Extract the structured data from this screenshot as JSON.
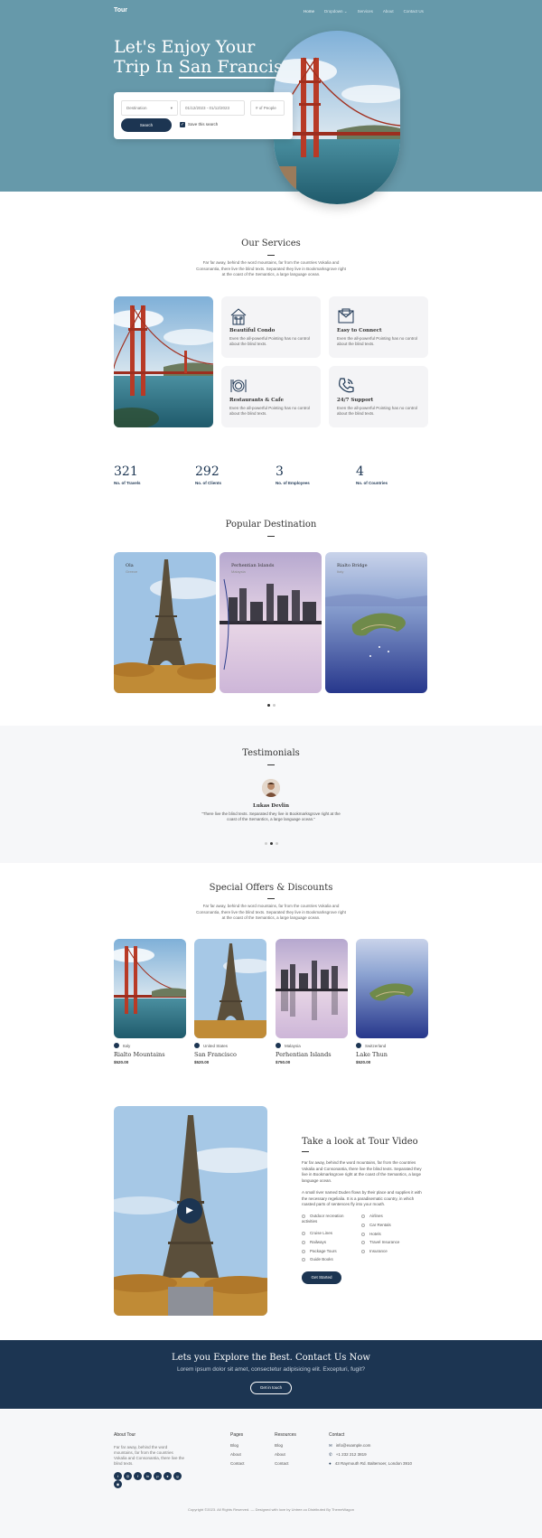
{
  "brand": {
    "logo": "Tour",
    "accent": "#1c3552",
    "hero_bg": "#6699aa"
  },
  "nav": {
    "items": [
      "Home",
      "Dropdown",
      "Services",
      "About",
      "Contact Us"
    ]
  },
  "hero": {
    "title_line1": "Let's Enjoy Your",
    "title_line2_prefix": "Trip In ",
    "title_highlight": "San Francisco.",
    "destination_placeholder": "Destination",
    "date_value": "01/12/2023 - 01/12/2023",
    "people_placeholder": "# of People",
    "search_label": "Search",
    "save_label": "Save this search"
  },
  "services": {
    "title": "Our Services",
    "subtitle": "Far far away, behind the word mountains, far from the countries Vokalia and Consonantia, there live the blind texts. Separated they live in Bookmarksgrove right at the coast of the Semantics, a large language ocean.",
    "cards": [
      {
        "icon": "condo-icon",
        "title": "Beautiful Condo",
        "text": "Even the all-powerful Pointing has no control about the blind texts."
      },
      {
        "icon": "email-icon",
        "title": "Easy to Connect",
        "text": "Even the all-powerful Pointing has no control about the blind texts."
      },
      {
        "icon": "dining-icon",
        "title": "Restaurants & Cafe",
        "text": "Even the all-powerful Pointing has no control about the blind texts."
      },
      {
        "icon": "phone-icon",
        "title": "24/7 Support",
        "text": "Even the all-powerful Pointing has no control about the blind texts."
      }
    ]
  },
  "stats": [
    {
      "num": "321",
      "label": "No. of Travels"
    },
    {
      "num": "292",
      "label": "No. of Clients"
    },
    {
      "num": "3",
      "label": "No. of Employees"
    },
    {
      "num": "4",
      "label": "No. of Countries"
    }
  ],
  "popular": {
    "title": "Popular Destination",
    "items": [
      {
        "name": "Ola",
        "sub": "Greece"
      },
      {
        "name": "Perhentian Islands",
        "sub": "Malaysia"
      },
      {
        "name": "Rialto Bridge",
        "sub": "Italy"
      }
    ]
  },
  "testimonials": {
    "title": "Testimonials",
    "name": "Lukas Devlin",
    "quote": "“There live the blind texts. Separated they live in Bookmarksgrove right at the coast of the Semantics, a large language ocean.”"
  },
  "offers": {
    "title": "Special Offers & Discounts",
    "subtitle": "Far far away, behind the word mountains, far from the countries Vokalia and Consonantia, there live the blind texts. Separated they live in Bookmarksgrove right at the coast of the Semantics, a large language ocean.",
    "items": [
      {
        "location": "Italy",
        "name": "Rialto Mountains",
        "price": "$520.00"
      },
      {
        "location": "United States",
        "name": "San Francisco",
        "price": "$520.00"
      },
      {
        "location": "Malaysia",
        "name": "Perhentian Islands",
        "price": "$750.00"
      },
      {
        "location": "Switzerland",
        "name": "Lake Thun",
        "price": "$520.00"
      }
    ]
  },
  "video": {
    "title": "Take a look at Tour Video",
    "p1": "Far far away, behind the word mountains, far from the countries Vokalia and Consonantia, there live the blind texts. Separated they live in Bookmarksgrove right at the coast of the Semantics, a large language ocean.",
    "p2": "A small river named Duden flows by their place and supplies it with the necessary regelialia. It is a paradisematic country, in which roasted parts of sentences fly into your mouth.",
    "col1": [
      "Outdoor recreation activities",
      "Cruise Lines",
      "Railways",
      "Package Tours",
      "Guide Books"
    ],
    "col2": [
      "Airlines",
      "Car Rentals",
      "Hotels",
      "Travel Insurance",
      "Insurance"
    ],
    "cta": "Get Started"
  },
  "cta": {
    "title": "Lets you Explore the Best. Contact Us Now",
    "subtitle": "Lorem ipsum dolor sit amet, consectetur adipisicing elit. Excepturi, fugit?",
    "button": "Get in touch"
  },
  "footer": {
    "about_title": "About Tour",
    "about_text": "Far far away, behind the word mountains, far from the countries Vokalia and Consonantia, there live the blind texts.",
    "pages_title": "Pages",
    "pages": [
      "Blog",
      "About",
      "Contact"
    ],
    "resources_title": "Resources",
    "resources": [
      "Blog",
      "About",
      "Contact"
    ],
    "contact_title": "Contact",
    "email": "info@example.com",
    "phone": "+1 232 212 3819",
    "address": "43 Raymouth Rd. Baltemoer, London 3910",
    "copyright": "Copyright ©2023. All Rights Reserved. — Designed with love by Untree.co Distributed By ThemeWagon"
  }
}
